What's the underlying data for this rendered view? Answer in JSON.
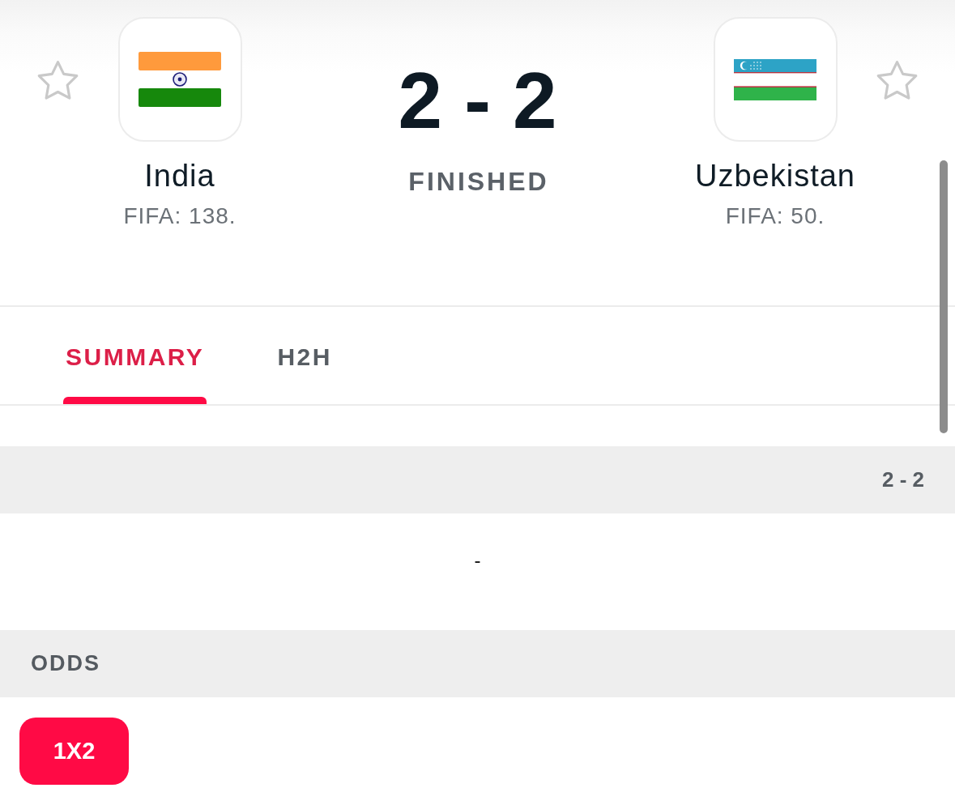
{
  "match": {
    "home": {
      "name": "India",
      "fifa_rank": "FIFA: 138.",
      "favorite": false
    },
    "score": "2 - 2",
    "status": "FINISHED",
    "away": {
      "name": "Uzbekistan",
      "fifa_rank": "FIFA: 50.",
      "favorite": false
    }
  },
  "tabs": [
    {
      "label": "SUMMARY",
      "selected": true
    },
    {
      "label": "H2H",
      "selected": false
    }
  ],
  "summary": {
    "period_score": "2 - 2",
    "incidents": "-"
  },
  "odds": {
    "title": "ODDS",
    "markets": [
      {
        "label": "1X2",
        "selected": true
      }
    ]
  }
}
